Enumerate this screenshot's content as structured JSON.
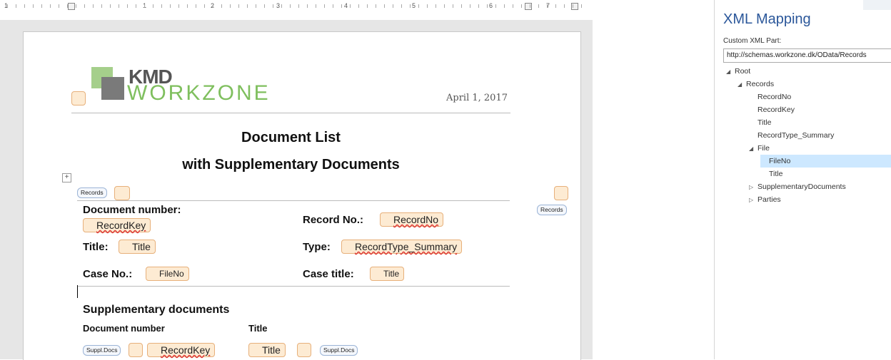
{
  "ruler": {
    "labels": [
      "1",
      "1",
      "2",
      "3",
      "4",
      "5",
      "6",
      "7"
    ]
  },
  "document": {
    "date": "April 1, 2017",
    "logo": {
      "brand": "KMD",
      "product": "WORKZONE"
    },
    "title_line1": "Document List",
    "title_line2": "with Supplementary Documents",
    "records_tag": "Records",
    "records_tag_end": "Records",
    "fields": {
      "doc_number_label": "Document number:",
      "record_key": "RecordKey",
      "record_no_label": "Record No.:",
      "record_no": "RecordNo",
      "title_label": "Title:",
      "title_value": "Title",
      "type_label": "Type:",
      "type_value": "RecordType_Summary",
      "case_no_label": "Case No.:",
      "case_no": "FileNo",
      "case_title_label": "Case title:",
      "case_title": "Title"
    },
    "supp": {
      "heading": "Supplementary documents",
      "col_docnum": "Document number",
      "col_title": "Title",
      "tag": "Suppl.Docs",
      "tag_end": "Suppl.Docs",
      "record_key": "RecordKey",
      "title": "Title"
    }
  },
  "pane": {
    "title": "XML Mapping",
    "custom_part_label": "Custom XML Part:",
    "custom_part_value": "http://schemas.workzone.dk/OData/Records",
    "tree": [
      {
        "label": "Root",
        "expander": "◢"
      },
      {
        "label": "Records",
        "expander": "◢"
      },
      {
        "label": "RecordNo",
        "expander": ""
      },
      {
        "label": "RecordKey",
        "expander": ""
      },
      {
        "label": "Title",
        "expander": ""
      },
      {
        "label": "RecordType_Summary",
        "expander": ""
      },
      {
        "label": "File",
        "expander": "◢"
      },
      {
        "label": "FileNo",
        "expander": ""
      },
      {
        "label": "Title",
        "expander": ""
      },
      {
        "label": "SupplementaryDocuments",
        "expander": "▷"
      },
      {
        "label": "Parties",
        "expander": "▷"
      }
    ]
  }
}
